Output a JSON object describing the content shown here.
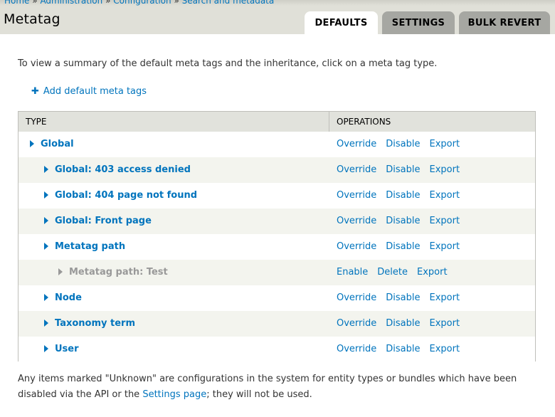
{
  "breadcrumb": {
    "items": [
      "Home",
      "Administration",
      "Configuration",
      "Search and metadata"
    ],
    "separator": "»"
  },
  "page_title": "Metatag",
  "tabs": [
    {
      "label": "DEFAULTS",
      "active": true
    },
    {
      "label": "SETTINGS",
      "active": false
    },
    {
      "label": "BULK REVERT",
      "active": false
    }
  ],
  "intro_text": "To view a summary of the default meta tags and the inheritance, click on a meta tag type.",
  "add_link": {
    "label": "Add default meta tags",
    "icon": "plus-icon"
  },
  "table": {
    "headers": {
      "type": "TYPE",
      "operations": "OPERATIONS"
    },
    "rows": [
      {
        "name": "Global",
        "level": 0,
        "disabled": false,
        "ops": [
          "Override",
          "Disable",
          "Export"
        ]
      },
      {
        "name": "Global: 403 access denied",
        "level": 1,
        "disabled": false,
        "ops": [
          "Override",
          "Disable",
          "Export"
        ]
      },
      {
        "name": "Global: 404 page not found",
        "level": 1,
        "disabled": false,
        "ops": [
          "Override",
          "Disable",
          "Export"
        ]
      },
      {
        "name": "Global: Front page",
        "level": 1,
        "disabled": false,
        "ops": [
          "Override",
          "Disable",
          "Export"
        ]
      },
      {
        "name": "Metatag path",
        "level": 1,
        "disabled": false,
        "ops": [
          "Override",
          "Disable",
          "Export"
        ]
      },
      {
        "name": "Metatag path: Test",
        "level": 2,
        "disabled": true,
        "ops": [
          "Enable",
          "Delete",
          "Export"
        ]
      },
      {
        "name": "Node",
        "level": 1,
        "disabled": false,
        "ops": [
          "Override",
          "Disable",
          "Export"
        ]
      },
      {
        "name": "Taxonomy term",
        "level": 1,
        "disabled": false,
        "ops": [
          "Override",
          "Disable",
          "Export"
        ]
      },
      {
        "name": "User",
        "level": 1,
        "disabled": false,
        "ops": [
          "Override",
          "Disable",
          "Export"
        ]
      }
    ]
  },
  "footer": {
    "before_link": "Any items marked \"Unknown\" are configurations in the system for entity types or bundles which have been disabled via the API or the ",
    "link": "Settings page",
    "after_link": "; they will not be used."
  },
  "colors": {
    "link": "#0074bd",
    "header_bg": "#e0e0d8",
    "tab_inactive": "#a6a7a2",
    "row_alt": "#f3f4ee"
  }
}
